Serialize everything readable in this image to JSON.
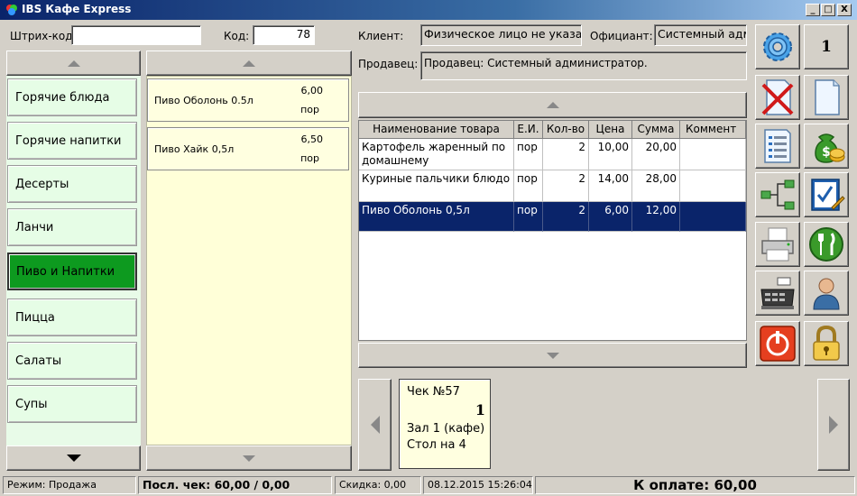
{
  "window": {
    "title": "IBS Кафе Express",
    "controls": {
      "minimize": "_",
      "maximize": "□",
      "close": "X"
    }
  },
  "barcode": {
    "label": "Штрих-код:",
    "value": ""
  },
  "code": {
    "label": "Код:",
    "value": "78"
  },
  "header": {
    "client_label": "Клиент:",
    "client_value": "Физическое лицо не указано",
    "waiter_label": "Официант:",
    "waiter_value": "Системный администратор",
    "seller_label": "Продавец:",
    "seller_value": "Продавец: Системный администратор.",
    "counter_value": "1"
  },
  "categories": [
    {
      "label": "Горячие блюда",
      "active": false
    },
    {
      "label": "Горячие напитки",
      "active": false
    },
    {
      "label": "Десерты",
      "active": false
    },
    {
      "label": "Ланчи",
      "active": false
    },
    {
      "label": "Пиво и Напитки",
      "active": true
    },
    {
      "label": "Пицца",
      "active": false
    },
    {
      "label": "Салаты",
      "active": false
    },
    {
      "label": "Супы",
      "active": false
    }
  ],
  "products": [
    {
      "name": "Пиво Оболонь 0.5л",
      "price": "6,00",
      "unit": "пор"
    },
    {
      "name": "Пиво Хайк 0,5л",
      "price": "6,50",
      "unit": "пор"
    }
  ],
  "order_table": {
    "columns": [
      "Наименование товара",
      "Е.И.",
      "Кол-во",
      "Цена",
      "Сумма",
      "Коммент"
    ],
    "rows": [
      {
        "name": "Картофель жаренный по домашнему",
        "unit": "пор",
        "qty": "2",
        "price": "10,00",
        "sum": "20,00",
        "comment": "",
        "selected": false
      },
      {
        "name": "Куриные пальчики блюдо",
        "unit": "пор",
        "qty": "2",
        "price": "14,00",
        "sum": "28,00",
        "comment": "",
        "selected": false
      },
      {
        "name": "Пиво Оболонь 0,5л",
        "unit": "пор",
        "qty": "2",
        "price": "6,00",
        "sum": "12,00",
        "comment": "",
        "selected": true
      }
    ]
  },
  "check": {
    "number": "Чек №57",
    "guests": "1",
    "hall": "Зал 1 (кафе)",
    "table": "Стол на 4"
  },
  "toolbar_icons": [
    "settings-gear-icon",
    "counter-display",
    "delete-document-icon",
    "new-document-icon",
    "document-list-icon",
    "money-bag-icon",
    "tree-split-icon",
    "checklist-edit-icon",
    "printer-icon",
    "cutlery-icon",
    "cash-register-icon",
    "user-icon",
    "power-exit-icon",
    "lock-icon"
  ],
  "status_bar": {
    "mode": "Режим: Продажа",
    "last_check": "Посл. чек: 60,00 / 0,00",
    "discount": "Скидка: 0,00",
    "datetime": "08.12.2015 15:26:04",
    "to_pay": "К оплате: 60,00"
  },
  "colors": {
    "category_bg": "#e6fde6",
    "category_active": "#0d9a1f",
    "product_bg": "#ffffe0",
    "selection": "#0a246a"
  }
}
